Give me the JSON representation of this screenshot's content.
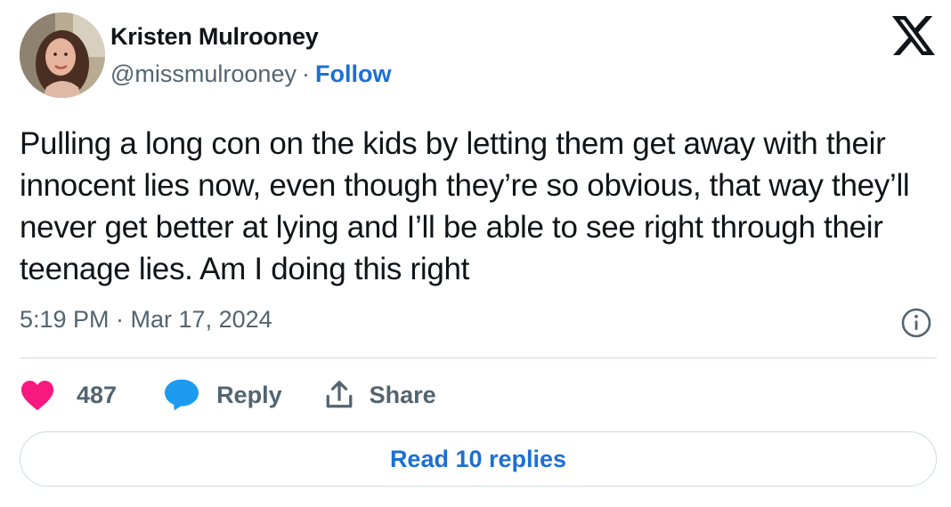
{
  "author": {
    "name": "Kristen Mulrooney",
    "handle": "@missmulrooney",
    "separator": "·",
    "follow_label": "Follow"
  },
  "tweet": {
    "text": "Pulling a long con on the kids by letting them get away with their innocent lies now, even though they’re so obvious, that way they’ll never get better at lying and I’ll be able to see right through their teenage lies. Am I doing this right",
    "timestamp": "5:19 PM · Mar 17, 2024"
  },
  "actions": {
    "like_count": "487",
    "reply_label": "Reply",
    "share_label": "Share"
  },
  "footer": {
    "read_replies_label": "Read 10 replies"
  },
  "icons": {
    "brand": "x-logo-icon",
    "info": "info-icon",
    "like": "heart-icon",
    "reply": "speech-bubble-icon",
    "share": "share-icon"
  },
  "colors": {
    "link": "#1d6fd6",
    "heart": "#f91880",
    "reply_bubble": "#1d9bf0",
    "secondary_text": "#536471",
    "divider": "#cfd9de"
  }
}
